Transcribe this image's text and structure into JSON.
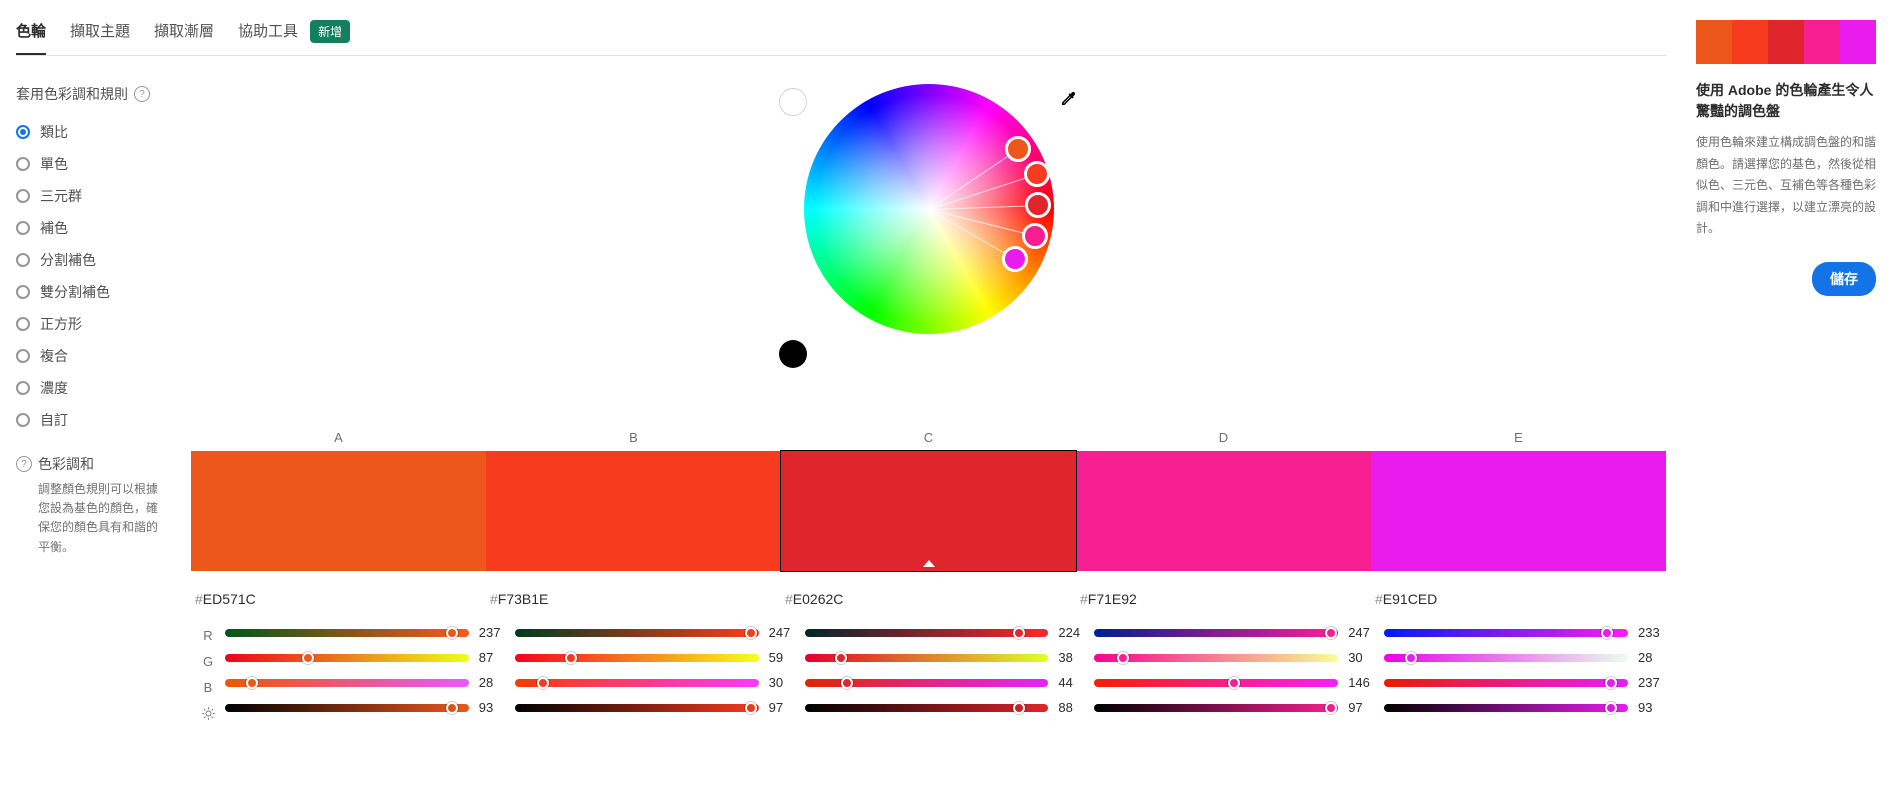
{
  "tabs": {
    "wheel": "色輪",
    "extract_theme": "擷取主題",
    "extract_gradient": "擷取漸層",
    "accessibility": "協助工具",
    "new_badge": "新增"
  },
  "rules": {
    "header": "套用色彩調和規則",
    "items": [
      {
        "id": "analogous",
        "label": "類比"
      },
      {
        "id": "mono",
        "label": "單色"
      },
      {
        "id": "triad",
        "label": "三元群"
      },
      {
        "id": "complementary",
        "label": "補色"
      },
      {
        "id": "split",
        "label": "分割補色"
      },
      {
        "id": "double-split",
        "label": "雙分割補色"
      },
      {
        "id": "square",
        "label": "正方形"
      },
      {
        "id": "compound",
        "label": "複合"
      },
      {
        "id": "shades",
        "label": "濃度"
      },
      {
        "id": "custom",
        "label": "自訂"
      }
    ],
    "selected": "analogous"
  },
  "harmony": {
    "title": "色彩調和",
    "desc": "調整顏色規則可以根據您設為基色的顏色，確保您的顏色具有和諧的平衡。"
  },
  "swatches": {
    "letters": [
      "A",
      "B",
      "C",
      "D",
      "E"
    ],
    "active_index": 2,
    "colors": [
      {
        "hex": "ED571C",
        "r": 237,
        "g": 87,
        "b": 28,
        "l": 93
      },
      {
        "hex": "F73B1E",
        "r": 247,
        "g": 59,
        "b": 30,
        "l": 97
      },
      {
        "hex": "E0262C",
        "r": 224,
        "g": 38,
        "b": 44,
        "l": 88
      },
      {
        "hex": "F71E92",
        "r": 247,
        "g": 30,
        "b": 146,
        "l": 97
      },
      {
        "hex": "E91CED",
        "r": 233,
        "g": 28,
        "b": 237,
        "l": 93
      }
    ]
  },
  "slider_labels": {
    "r": "R",
    "g": "G",
    "b": "B"
  },
  "hex_prefix": "#",
  "wheel_markers": [
    {
      "angle": -34,
      "radius": 108
    },
    {
      "angle": -18,
      "radius": 114
    },
    {
      "angle": -2,
      "radius": 110
    },
    {
      "angle": 14,
      "radius": 110
    },
    {
      "angle": 30,
      "radius": 100
    }
  ],
  "promo": {
    "title": "使用 Adobe 的色輪產生令人驚豔的調色盤",
    "body": "使用色輪來建立構成調色盤的和諧顏色。請選擇您的基色，然後從相似色、三元色、互補色等各種色彩調和中進行選擇，以建立漂亮的設計。",
    "save": "儲存"
  }
}
